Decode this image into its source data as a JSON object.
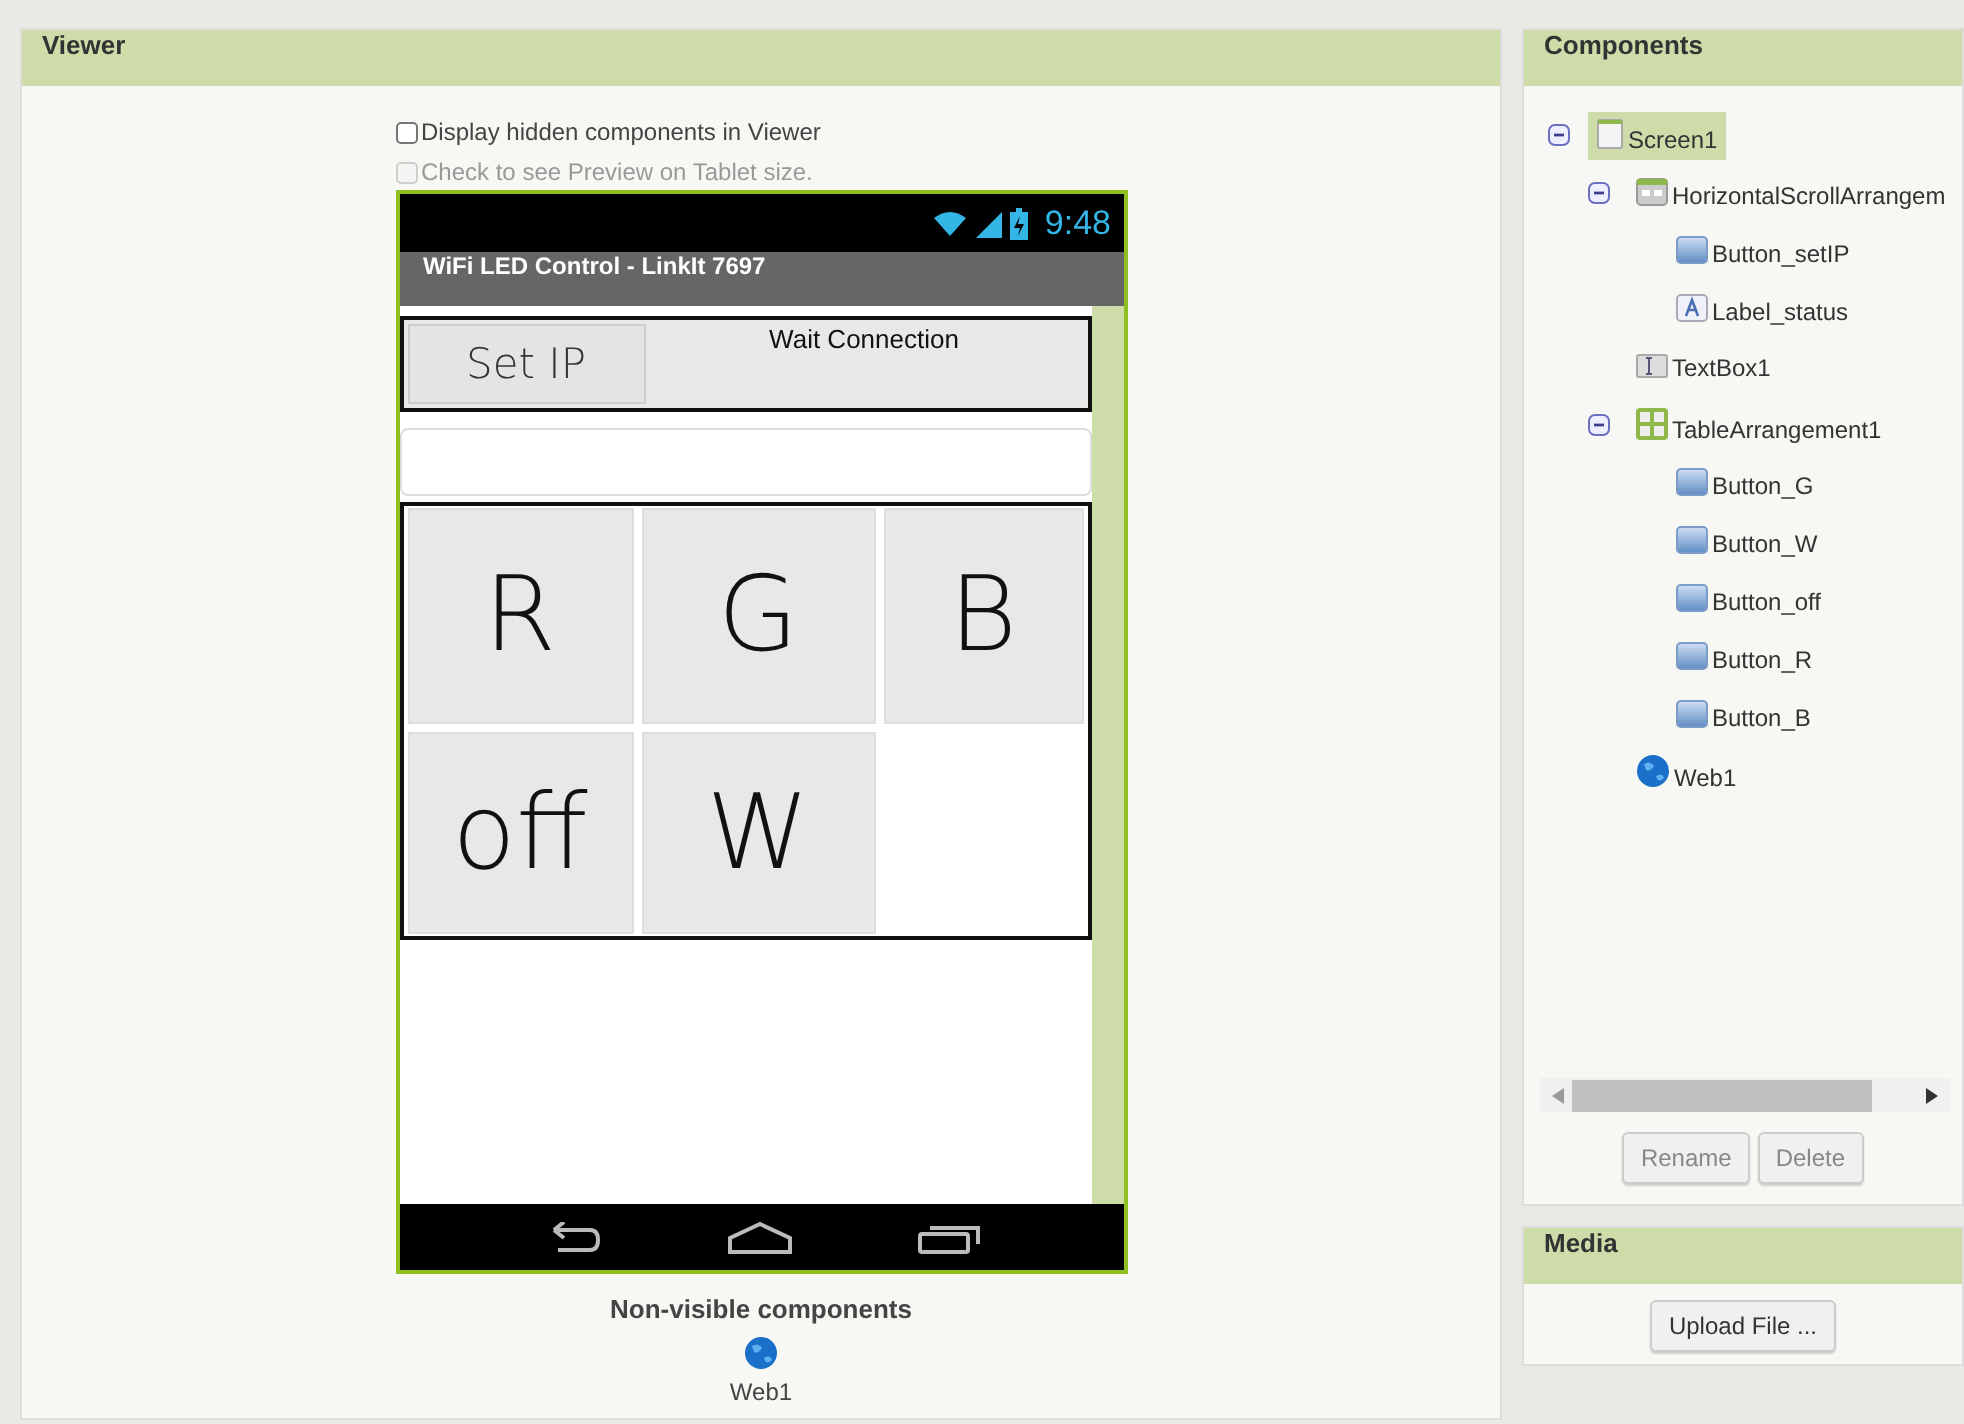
{
  "viewer": {
    "title": "Viewer",
    "options": [
      {
        "label": "Display hidden components in Viewer",
        "checked": false,
        "disabled": false
      },
      {
        "label": "Check to see Preview on Tablet size.",
        "checked": false,
        "disabled": true
      }
    ],
    "phone": {
      "time": "9:48",
      "app_title": "WiFi LED Control - LinkIt 7697",
      "set_ip_button": "Set IP",
      "status_label": "Wait Connection",
      "grid": [
        [
          "R",
          "G",
          "B"
        ],
        [
          "off",
          "W"
        ]
      ]
    },
    "non_visible": {
      "title": "Non-visible components",
      "items": [
        {
          "label": "Web1"
        }
      ]
    }
  },
  "components": {
    "title": "Components",
    "tree": [
      {
        "label": "Screen1",
        "kind": "screen",
        "selected": true,
        "expanded": true,
        "children": [
          {
            "label": "HorizontalScrollArrangem",
            "kind": "arrangement",
            "selected": false,
            "expanded": true,
            "children": [
              {
                "label": "Button_setIP",
                "kind": "button",
                "selected": false
              },
              {
                "label": "Label_status",
                "kind": "label",
                "selected": false
              }
            ]
          },
          {
            "label": "TextBox1",
            "kind": "textbox",
            "selected": false
          },
          {
            "label": "TableArrangement1",
            "kind": "table",
            "selected": false,
            "expanded": true,
            "children": [
              {
                "label": "Button_G",
                "kind": "button",
                "selected": false
              },
              {
                "label": "Button_W",
                "kind": "button",
                "selected": false
              },
              {
                "label": "Button_off",
                "kind": "button",
                "selected": false
              },
              {
                "label": "Button_R",
                "kind": "button",
                "selected": false
              },
              {
                "label": "Button_B",
                "kind": "button",
                "selected": false
              }
            ]
          },
          {
            "label": "Web1",
            "kind": "web",
            "selected": false
          }
        ]
      }
    ],
    "buttons": [
      {
        "label": "Rename",
        "disabled": true
      },
      {
        "label": "Delete",
        "disabled": true
      }
    ]
  },
  "media": {
    "title": "Media",
    "upload_button": "Upload File ..."
  }
}
